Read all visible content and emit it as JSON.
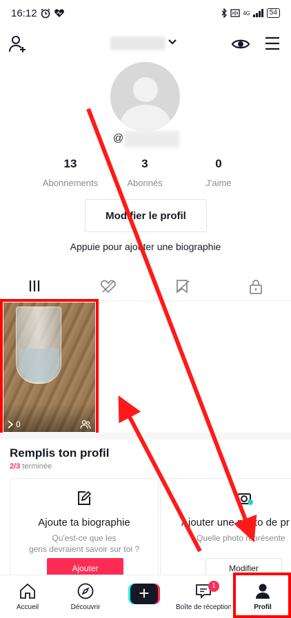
{
  "status": {
    "time": "16:12",
    "battery": "54",
    "network": "4G"
  },
  "profile": {
    "handle_prefix": "@",
    "stats": [
      {
        "value": "13",
        "label": "Abonnements"
      },
      {
        "value": "3",
        "label": "Abonnés"
      },
      {
        "value": "0",
        "label": "J'aime"
      }
    ],
    "edit_label": "Modifier le profil",
    "bio_hint": "Appuie pour ajouter une biographie"
  },
  "video": {
    "views": "0"
  },
  "fill_profile": {
    "title": "Remplis ton profil",
    "progress_count": "2/3",
    "progress_label": "terminée",
    "cards": [
      {
        "title": "Ajoute ta biographie",
        "desc_line1": "Qu'est-ce que les",
        "desc_line2": "gens devraient savoir sur toi ?",
        "button": "Ajouter"
      },
      {
        "title": "Ajouter une photo de pr",
        "desc_line1": "Quelle photo représente",
        "button": "Modifier"
      }
    ]
  },
  "nav": {
    "items": [
      {
        "label": "Accueil"
      },
      {
        "label": "Découvrir"
      },
      {
        "label": "Boîte de réception"
      },
      {
        "label": "Profil"
      }
    ],
    "inbox_badge": "1"
  },
  "colors": {
    "accent": "#fe2c55",
    "highlight": "#ff0000",
    "cyan": "#25f4ee"
  }
}
